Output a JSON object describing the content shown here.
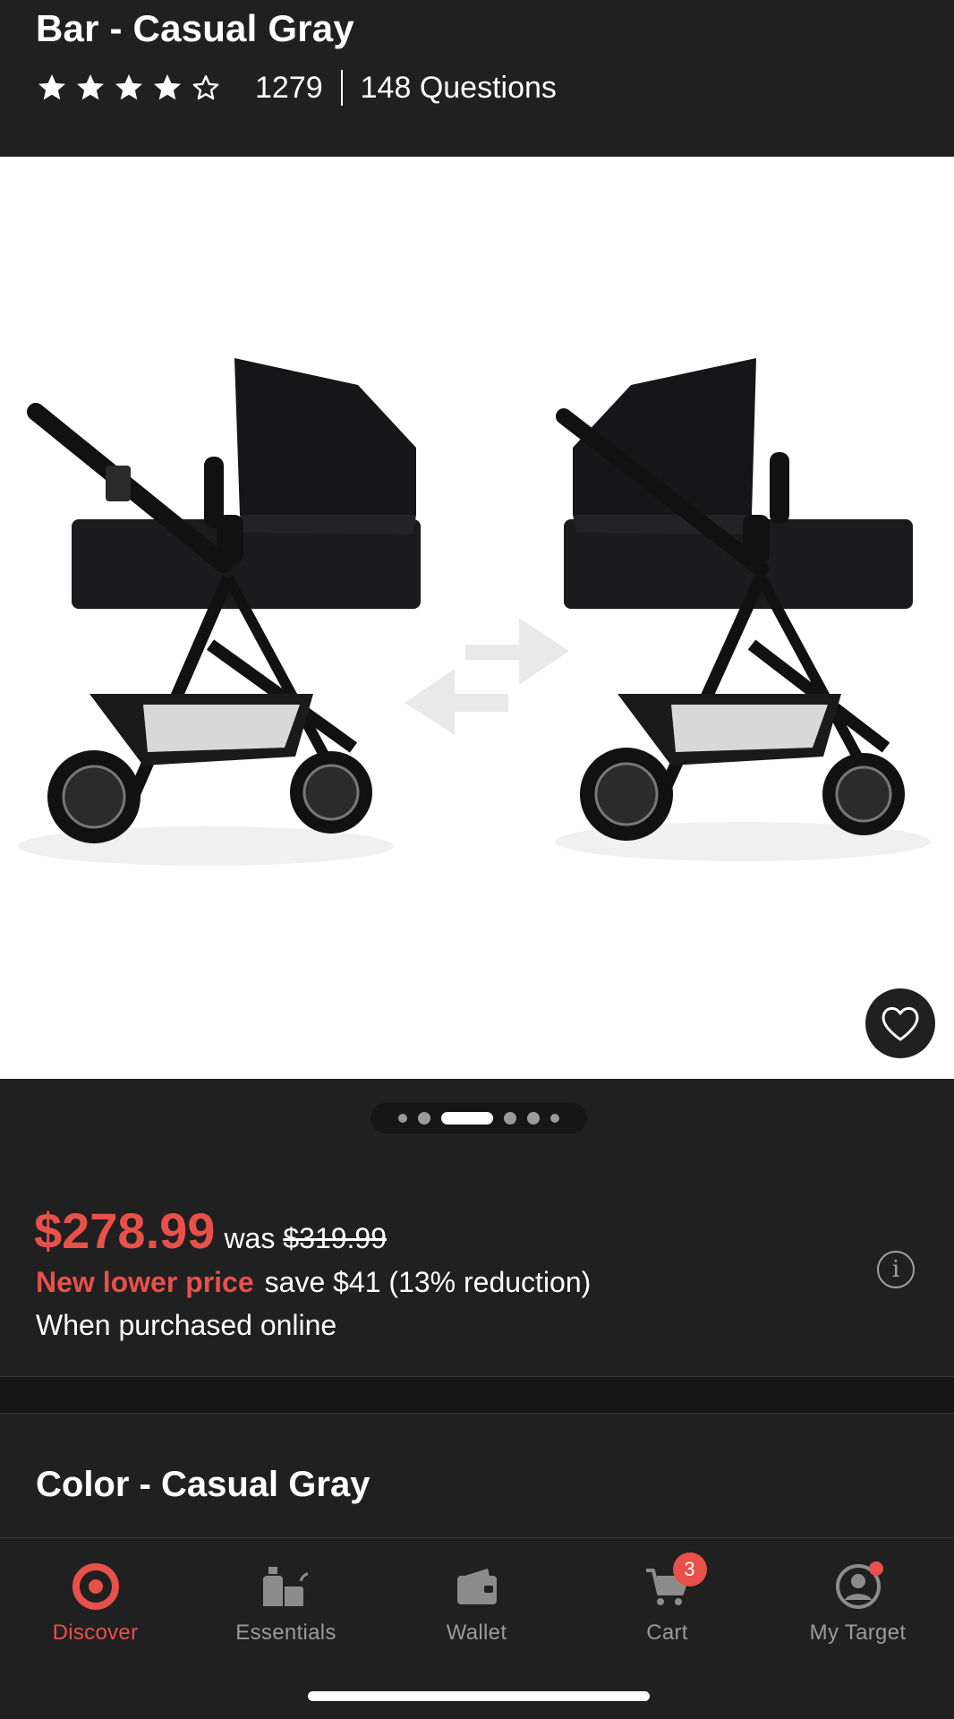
{
  "header": {
    "title": "Bar - Casual Gray",
    "rating": {
      "value": 4,
      "max": 5
    },
    "review_count": "1279",
    "questions": "148 Questions"
  },
  "gallery": {
    "image_alt": "Stroller shown facing both directions",
    "dot_count": 6,
    "active_index": 2
  },
  "pricing": {
    "price": "$278.99",
    "was_label": "was",
    "was_price": "$319.99",
    "promo": "New lower price",
    "savings": "save $41 (13% reduction)",
    "availability": "When purchased online",
    "info_icon": "info-icon"
  },
  "color": {
    "title": "Color - Casual Gray"
  },
  "tabbar": {
    "tabs": [
      {
        "label": "Discover",
        "icon": "target-icon",
        "active": true
      },
      {
        "label": "Essentials",
        "icon": "essentials-icon",
        "active": false
      },
      {
        "label": "Wallet",
        "icon": "wallet-icon",
        "active": false
      },
      {
        "label": "Cart",
        "icon": "cart-icon",
        "active": false,
        "badge": "3"
      },
      {
        "label": "My Target",
        "icon": "profile-icon",
        "active": false
      }
    ]
  },
  "colors": {
    "background": "#202021",
    "accent": "#e8504a",
    "text": "#ffffff",
    "muted": "#9a9a9a"
  }
}
